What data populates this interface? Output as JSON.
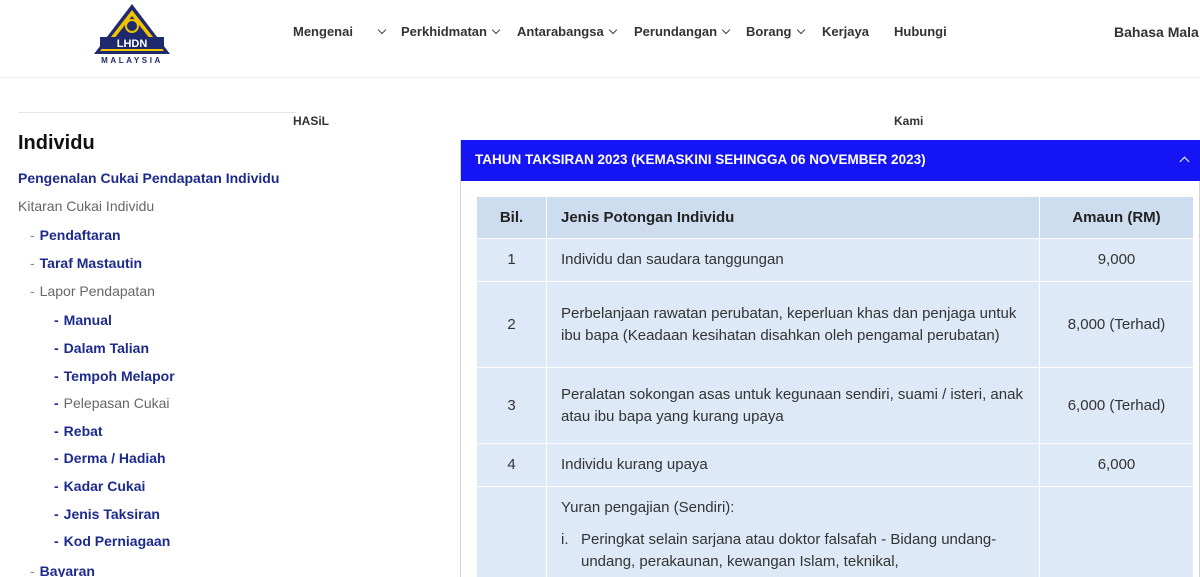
{
  "header": {
    "logo_text": "LHDN",
    "logo_subtext": "MALAYSIA",
    "nav": [
      {
        "label": "Mengenai",
        "has_dropdown": true,
        "sub": "HASiL"
      },
      {
        "label": "Perkhidmatan",
        "has_dropdown": true
      },
      {
        "label": "Antarabangsa",
        "has_dropdown": true
      },
      {
        "label": "Perundangan",
        "has_dropdown": true
      },
      {
        "label": "Borang",
        "has_dropdown": true
      },
      {
        "label": "Kerjaya",
        "has_dropdown": false
      },
      {
        "label": "Hubungi",
        "has_dropdown": false,
        "sub": "Kami"
      },
      {
        "label": "Bahasa Mala",
        "has_dropdown": false
      }
    ]
  },
  "sidebar": {
    "title": "Individu",
    "items": [
      {
        "label": "Pengenalan Cukai Pendapatan Individu",
        "level": 0,
        "style": "blue"
      },
      {
        "label": "Kitaran Cukai Individu",
        "level": 0,
        "style": "grey"
      },
      {
        "label": "Pendaftaran",
        "level": 1,
        "style": "blue"
      },
      {
        "label": "Taraf Mastautin",
        "level": 1,
        "style": "blue"
      },
      {
        "label": "Lapor Pendapatan",
        "level": 1,
        "style": "grey"
      },
      {
        "label": "Manual",
        "level": 2,
        "style": "blue"
      },
      {
        "label": "Dalam Talian",
        "level": 2,
        "style": "blue"
      },
      {
        "label": "Tempoh Melapor",
        "level": 2,
        "style": "blue"
      },
      {
        "label": "Pelepasan Cukai",
        "level": 2,
        "style": "grey"
      },
      {
        "label": "Rebat",
        "level": 2,
        "style": "blue"
      },
      {
        "label": "Derma / Hadiah",
        "level": 2,
        "style": "blue"
      },
      {
        "label": "Kadar Cukai",
        "level": 2,
        "style": "blue"
      },
      {
        "label": "Jenis Taksiran",
        "level": 2,
        "style": "blue"
      },
      {
        "label": "Kod Perniagaan",
        "level": 2,
        "style": "blue"
      },
      {
        "label": "Bayaran",
        "level": 1,
        "style": "blue"
      }
    ]
  },
  "panel": {
    "title": "TAHUN TAKSIRAN 2023 (KEMASKINI SEHINGGA 06 NOVEMBER 2023)",
    "expanded": true
  },
  "table": {
    "headers": {
      "bil": "Bil.",
      "jenis": "Jenis Potongan Individu",
      "amaun": "Amaun (RM)"
    },
    "rows": [
      {
        "bil": "1",
        "jenis": "Individu dan saudara tanggungan",
        "amaun": "9,000"
      },
      {
        "bil": "2",
        "jenis": "Perbelanjaan rawatan perubatan, keperluan khas dan penjaga untuk ibu bapa (Keadaan kesihatan disahkan oleh pengamal perubatan)",
        "amaun": "8,000 (Terhad)"
      },
      {
        "bil": "3",
        "jenis": "Peralatan sokongan asas untuk kegunaan sendiri, suami / isteri, anak atau ibu bapa yang kurang upaya",
        "amaun": "6,000 (Terhad)"
      },
      {
        "bil": "4",
        "jenis": "Individu kurang upaya",
        "amaun": "6,000"
      },
      {
        "bil": "",
        "jenis": "Yuran pengajian (Sendiri):",
        "amaun": "",
        "sub_items": [
          {
            "num": "i.",
            "text": "Peringkat selain sarjana atau doktor falsafah - Bidang undang-undang, perakaunan, kewangan Islam, teknikal,"
          }
        ]
      }
    ]
  },
  "colors": {
    "panel_header": "#1414f5",
    "link_blue": "#1c2a8c",
    "table_bg": "#dde9f6",
    "table_header_bg": "#cddcee"
  }
}
